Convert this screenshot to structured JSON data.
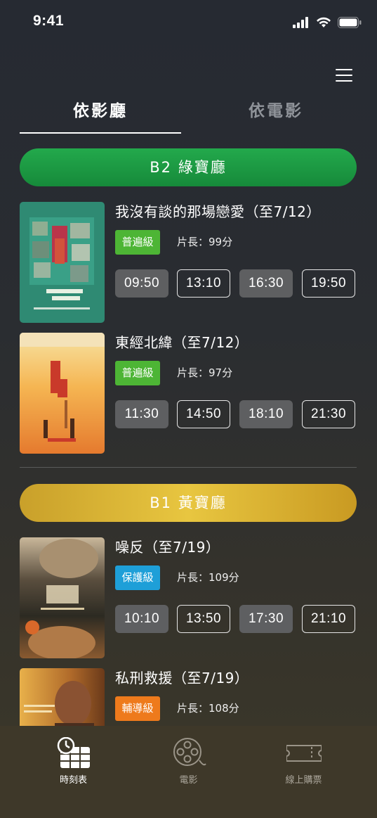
{
  "status_bar": {
    "time": "9:41"
  },
  "tabs": [
    {
      "label": "依影廳",
      "active": true
    },
    {
      "label": "依電影",
      "active": false
    }
  ],
  "halls": [
    {
      "name": "B2 綠寶廳",
      "color": "#1b9a43",
      "movies": [
        {
          "title": "我沒有談的那場戀愛（至7/12）",
          "rating": "普遍級",
          "rating_color": "#4db535",
          "duration": "片長：99分",
          "showtimes": [
            "09:50",
            "13:10",
            "16:30",
            "19:50"
          ]
        },
        {
          "title": "東經北緯（至7/12）",
          "rating": "普遍級",
          "rating_color": "#4db535",
          "duration": "片長：97分",
          "showtimes": [
            "11:30",
            "14:50",
            "18:10",
            "21:30"
          ]
        }
      ]
    },
    {
      "name": "B1 黃寶廳",
      "color": "#d9b435",
      "movies": [
        {
          "title": "噪反（至7/19）",
          "rating": "保護級",
          "rating_color": "#1e9fd8",
          "duration": "片長：109分",
          "showtimes": [
            "10:10",
            "13:50",
            "17:30",
            "21:10"
          ]
        },
        {
          "title": "私刑救援（至7/19）",
          "rating": "輔導級",
          "rating_color": "#ee7a1c",
          "duration": "片長：108分",
          "showtimes": []
        }
      ]
    }
  ],
  "bottom_nav": [
    {
      "label": "時刻表",
      "icon": "timetable-icon",
      "active": true
    },
    {
      "label": "電影",
      "icon": "film-reel-icon",
      "active": false
    },
    {
      "label": "線上購票",
      "icon": "ticket-icon",
      "active": false
    }
  ]
}
